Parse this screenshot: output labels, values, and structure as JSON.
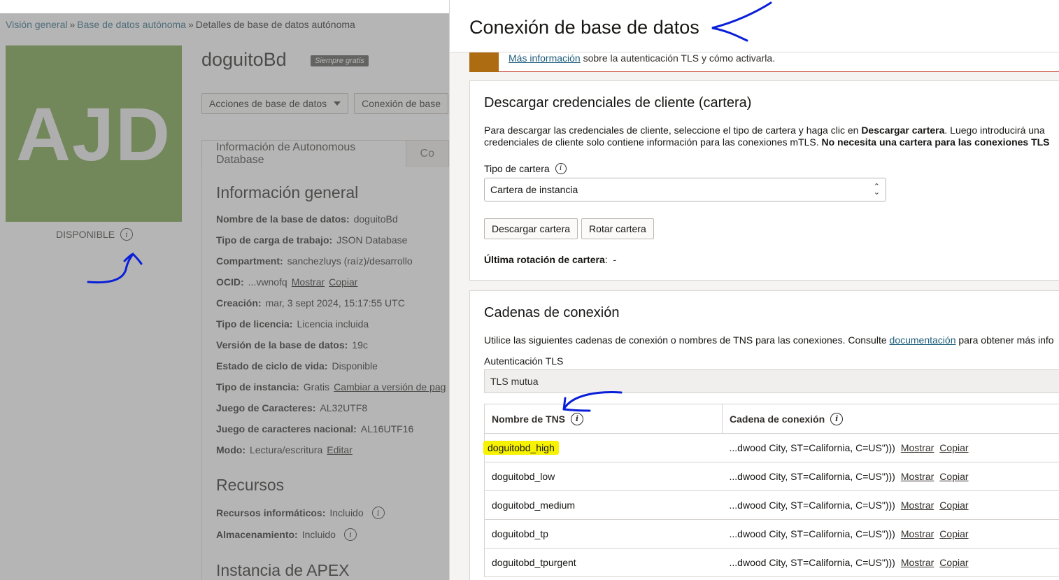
{
  "breadcrumb": {
    "items": [
      "Visión general",
      "Base de datos autónoma",
      "Detalles de base de datos autónoma"
    ],
    "separator": "»"
  },
  "database": {
    "tile_text": "AJD",
    "tile_color": "#6b9b37",
    "status": "DISPONIBLE",
    "name": "doguitoBd",
    "badge": "Siempre gratis"
  },
  "actions": {
    "db_actions": "Acciones de base de datos",
    "db_connection": "Conexión de base"
  },
  "tabs": {
    "info": "Información de Autonomous Database",
    "other": "Co"
  },
  "general": {
    "heading": "Información general",
    "fields": [
      {
        "label": "Nombre de la base de datos:",
        "value": "doguitoBd"
      },
      {
        "label": "Tipo de carga de trabajo:",
        "value": "JSON Database"
      },
      {
        "label": "Compartment:",
        "value": "sanchezluys (raíz)/desarrollo"
      },
      {
        "label": "OCID:",
        "value": "...vwnofq",
        "link1": "Mostrar",
        "link2": "Copiar"
      },
      {
        "label": "Creación:",
        "value": "mar, 3 sept 2024, 15:17:55 UTC"
      },
      {
        "label": "Tipo de licencia:",
        "value": "Licencia incluida"
      },
      {
        "label": "Versión de la base de datos:",
        "value": "19c"
      },
      {
        "label": "Estado de ciclo de vida:",
        "value": "Disponible"
      },
      {
        "label": "Tipo de instancia:",
        "value": "Gratis",
        "link1": "Cambiar a versión de pag"
      },
      {
        "label": "Juego de Caracteres:",
        "value": "AL32UTF8"
      },
      {
        "label": "Juego de caracteres nacional:",
        "value": "AL16UTF16"
      },
      {
        "label": "Modo:",
        "value": "Lectura/escritura",
        "link1": "Editar"
      }
    ]
  },
  "resources": {
    "heading": "Recursos",
    "fields": [
      {
        "label": "Recursos informáticos:",
        "value": "Incluido"
      },
      {
        "label": "Almacenamiento:",
        "value": "Incluido"
      }
    ]
  },
  "apex": {
    "heading": "Instancia de APEX"
  },
  "drawer": {
    "title": "Conexión de base de datos",
    "notice": {
      "link": "Más información",
      "text": "sobre la autenticación TLS y cómo activarla."
    },
    "wallet": {
      "heading": "Descargar credenciales de cliente (cartera)",
      "para_line1_a": "Para descargar las credenciales de cliente, seleccione el tipo de cartera y haga clic en ",
      "para_line1_b": "Descargar cartera",
      "para_line1_c": ". Luego introducirá una",
      "para_line2_a": "credenciales de cliente solo contiene información para las conexiones mTLS. ",
      "para_line2_b": "No necesita una cartera para las conexiones TLS",
      "type_label": "Tipo de cartera",
      "type_value": "Cartera de instancia",
      "download_button": "Descargar cartera",
      "rotate_button": "Rotar cartera",
      "last_rotation_label": "Última rotación de cartera",
      "last_rotation_value": "-"
    },
    "connections": {
      "heading": "Cadenas de conexión",
      "para_a": "Utilice las siguientes cadenas de conexión o nombres de TNS para las conexiones. Consulte ",
      "para_link": "documentación",
      "para_b": " para obtener más info",
      "tls_label": "Autenticación TLS",
      "tls_value": "TLS mutua",
      "col_tns": "Nombre de TNS",
      "col_conn": "Cadena de conexión",
      "rows": [
        {
          "name": "doguitobd_high",
          "conn": "...dwood City, ST=California, C=US\")))",
          "show": "Mostrar",
          "copy": "Copiar"
        },
        {
          "name": "doguitobd_low",
          "conn": "...dwood City, ST=California, C=US\")))",
          "show": "Mostrar",
          "copy": "Copiar"
        },
        {
          "name": "doguitobd_medium",
          "conn": "...dwood City, ST=California, C=US\")))",
          "show": "Mostrar",
          "copy": "Copiar"
        },
        {
          "name": "doguitobd_tp",
          "conn": "...dwood City, ST=California, C=US\")))",
          "show": "Mostrar",
          "copy": "Copiar"
        },
        {
          "name": "doguitobd_tpurgent",
          "conn": "...dwood City, ST=California, C=US\")))",
          "show": "Mostrar",
          "copy": "Copiar"
        }
      ]
    }
  },
  "colors": {
    "link": "#1c5d7a",
    "warning": "#ad6b12",
    "highlight": "#f7f300",
    "annotation": "#0a1fd8"
  }
}
